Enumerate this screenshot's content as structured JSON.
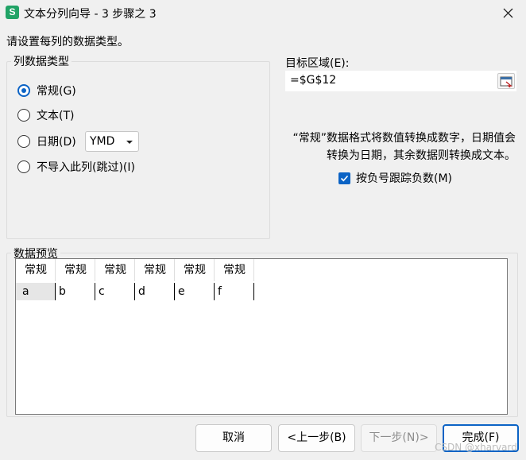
{
  "window": {
    "app_icon_letter": "S",
    "app_icon_color": "#21a366",
    "title": "文本分列向导 - 3 步骤之 3",
    "close_icon": "close-icon"
  },
  "instruction": "请设置每列的数据类型。",
  "column_type": {
    "legend": "列数据类型",
    "options": [
      {
        "label": "常规(G)",
        "checked": true
      },
      {
        "label": "文本(T)",
        "checked": false
      },
      {
        "label": "日期(D)",
        "checked": false
      },
      {
        "label": "不导入此列(跳过)(I)",
        "checked": false
      }
    ],
    "date_format": "YMD"
  },
  "destination": {
    "label": "目标区域(E):",
    "value": "=$G$12",
    "range_button_icon": "range-picker-icon"
  },
  "description": "“常规”数据格式将数值转换成数字，日期值会转换为日期，其余数据则转换成文本。",
  "negative_checkbox": {
    "label": "按负号跟踪负数(M)",
    "checked": true
  },
  "preview": {
    "legend": "数据预览",
    "headers": [
      "常规",
      "常规",
      "常规",
      "常规",
      "常规",
      "常规"
    ],
    "rows": [
      [
        "a",
        "b",
        "c",
        "d",
        "e",
        "f"
      ]
    ]
  },
  "buttons": {
    "cancel": "取消",
    "prev": "<上一步(B)",
    "next": "下一步(N)>",
    "finish": "完成(F)"
  },
  "watermark": "CSDN @xharvard",
  "colors": {
    "accent": "#0b63c5",
    "background": "#f0f0f0"
  }
}
